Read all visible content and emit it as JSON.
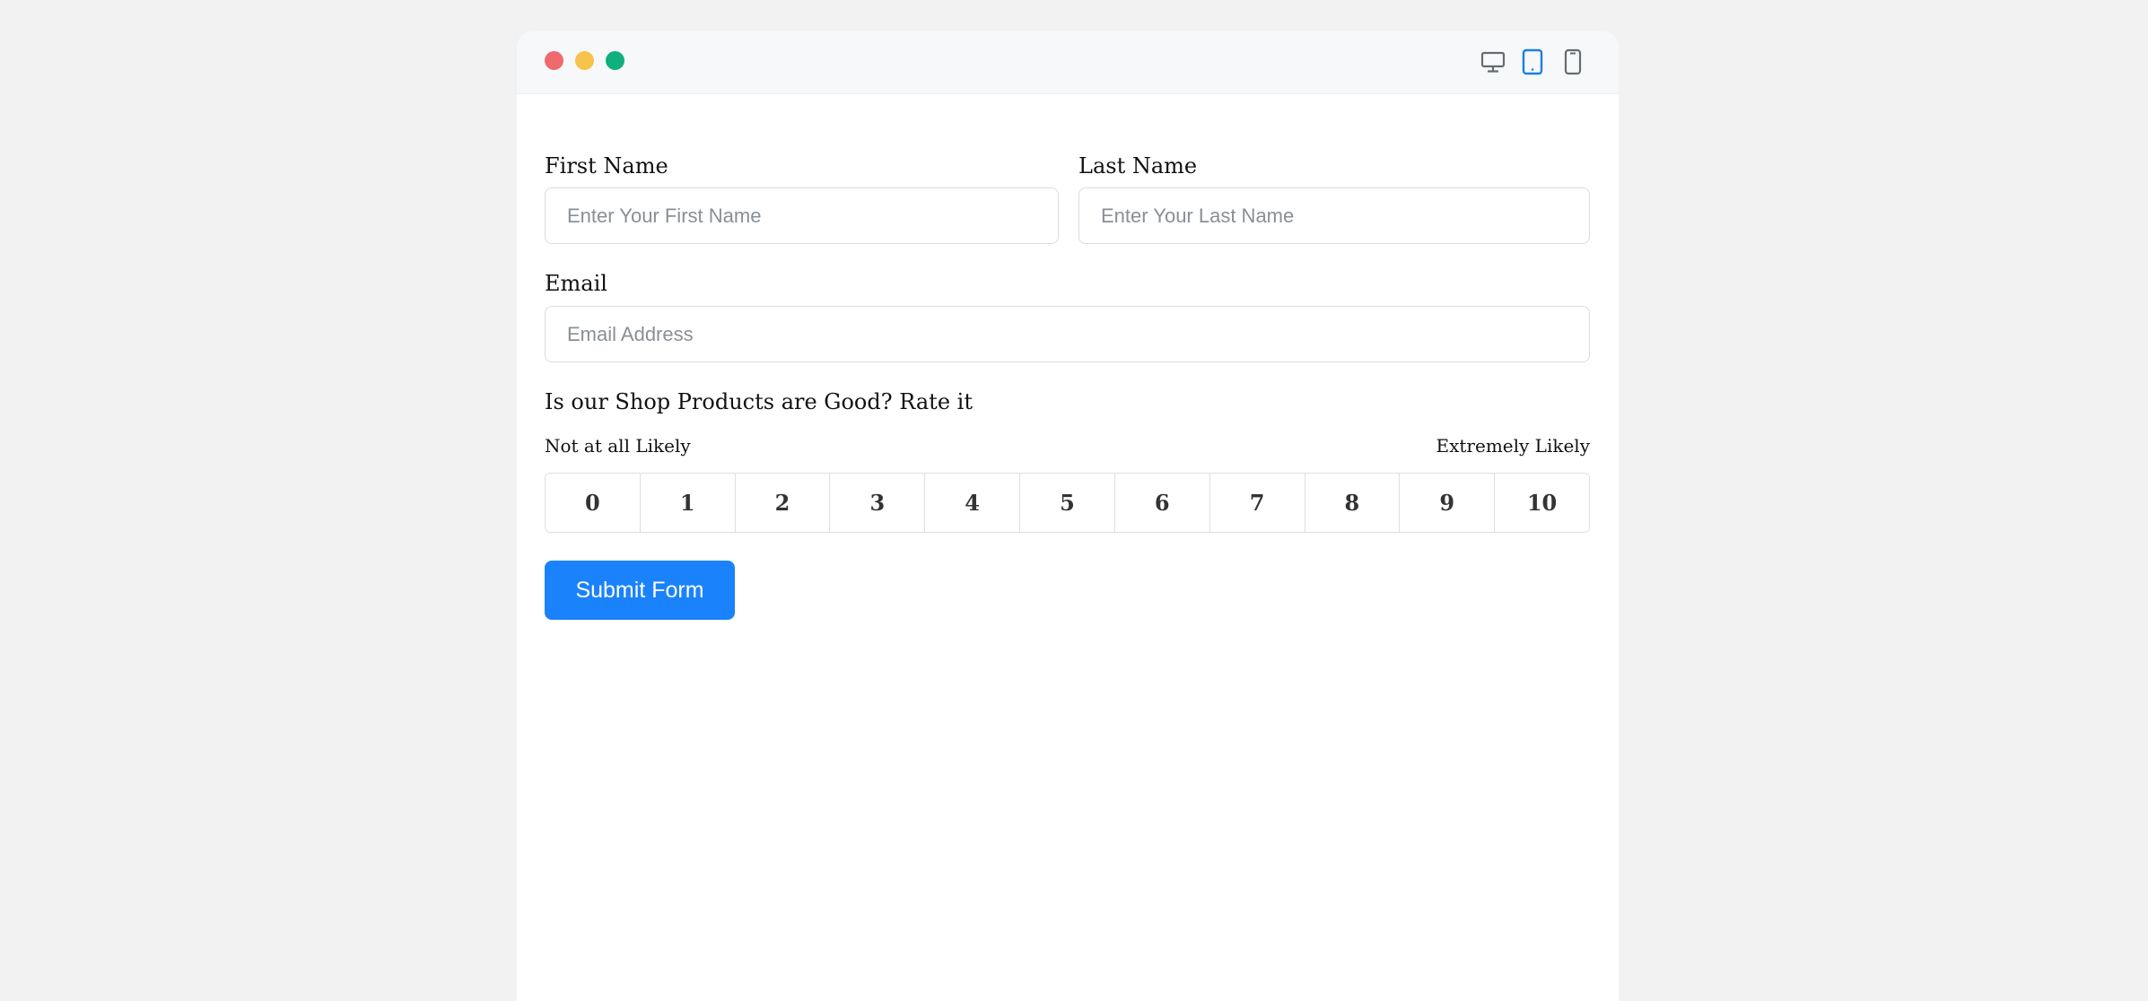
{
  "window": {
    "traffic_lights": [
      "#ee6a6e",
      "#f8c34b",
      "#0fb07e"
    ],
    "devices": [
      {
        "name": "desktop-icon",
        "active": false
      },
      {
        "name": "tablet-icon",
        "active": true
      },
      {
        "name": "mobile-icon",
        "active": false
      }
    ],
    "icon_color": "#666b70",
    "active_icon_color": "#1b7fe3"
  },
  "form": {
    "first_name": {
      "label": "First Name",
      "placeholder": "Enter Your First Name",
      "value": ""
    },
    "last_name": {
      "label": "Last Name",
      "placeholder": "Enter Your Last Name",
      "value": ""
    },
    "email": {
      "label": "Email",
      "placeholder": "Email Address",
      "value": ""
    },
    "rating": {
      "question": "Is our Shop Products are Good? Rate it",
      "low_label": "Not at all Likely",
      "high_label": "Extremely Likely",
      "options": [
        "0",
        "1",
        "2",
        "3",
        "4",
        "5",
        "6",
        "7",
        "8",
        "9",
        "10"
      ]
    },
    "submit_label": "Submit Form",
    "accent": "#1a82fb"
  }
}
